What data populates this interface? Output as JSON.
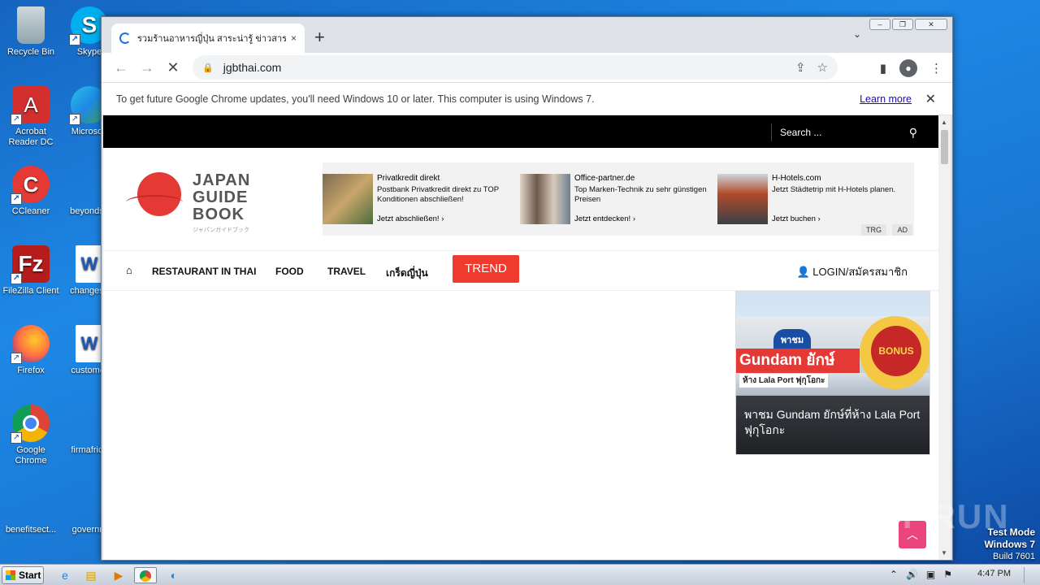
{
  "desktop": {
    "icons": [
      {
        "label": "Recycle Bin"
      },
      {
        "label": "Skype"
      },
      {
        "label": "Acrobat Reader DC"
      },
      {
        "label": "Microsoft"
      },
      {
        "label": "CCleaner"
      },
      {
        "label": "beyondse"
      },
      {
        "label": "FileZilla Client"
      },
      {
        "label": "changesp"
      },
      {
        "label": "Firefox"
      },
      {
        "label": "customer"
      },
      {
        "label": "Google Chrome"
      },
      {
        "label": "firmafrica"
      },
      {
        "label": "benefitsect..."
      },
      {
        "label": "governm"
      }
    ],
    "watermark": "ANY RUN",
    "test_mode": {
      "line1": "Test Mode",
      "line2": "Windows 7",
      "line3": "Build 7601"
    }
  },
  "browser": {
    "tab": {
      "title": "รวมร้านอาหารญี่ปุ่น สาระน่ารู้ ข่าวสาร ส",
      "close": "×"
    },
    "new_tab": "+",
    "url": "jgbthai.com",
    "infobar": {
      "message": "To get future Google Chrome updates, you'll need Windows 10 or later. This computer is using Windows 7.",
      "link": "Learn more"
    }
  },
  "site": {
    "search_placeholder": "Search ...",
    "logo": {
      "line1": "JAPAN",
      "line2": "GUIDE",
      "line3": "BOOK",
      "sub": "ジャパンガイドブック"
    },
    "ads": [
      {
        "title": "Privatkredit direkt",
        "desc": "Postbank Privatkredit direkt zu TOP Konditionen abschließen!",
        "cta": "Jetzt abschließen!  ›"
      },
      {
        "title": "Office-partner.de",
        "desc": "Top Marken-Technik zu sehr günstigen Preisen",
        "cta": "Jetzt entdecken!  ›"
      },
      {
        "title": "H-Hotels.com",
        "desc": "Jetzt Städtetrip mit H-Hotels planen.",
        "cta": "Jetzt buchen  ›"
      }
    ],
    "ad_tags": {
      "trg": "TRG",
      "ad": "AD"
    },
    "nav": {
      "restaurant": "RESTAURANT IN THAI",
      "food": "FOOD",
      "travel": "TRAVEL",
      "japan": "เกร็ดญี่ปุ่น",
      "trend": "TREND",
      "login": "LOGIN/สมัครสมาชิก"
    },
    "feature": {
      "badge": "พาชม",
      "banner": "Gundam ยักษ์",
      "sub": "ห้าง Lala Port ฟุกุโอกะ",
      "bonus": "BONUS",
      "caption": "พาชม Gundam ยักษ์ที่ห้าง Lala Port ฟุกุโอกะ"
    }
  },
  "taskbar": {
    "start": "Start",
    "clock": "4:47 PM"
  }
}
